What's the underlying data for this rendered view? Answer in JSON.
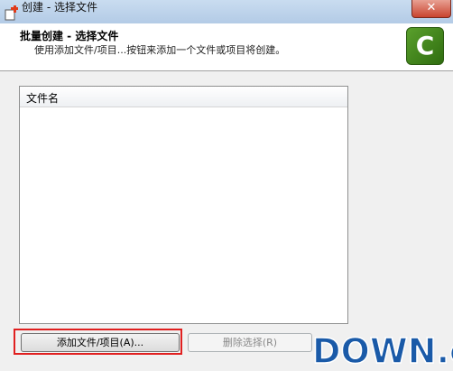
{
  "window": {
    "title": "创建 - 选择文件",
    "close_symbol": "✕",
    "app_icon": "app-window-icon"
  },
  "header": {
    "title": "批量创建 - 选择文件",
    "subtitle": "使用添加文件/项目...按钮来添加一个文件或项目将创建。",
    "logo_letter": "C",
    "logo_icon": "camtasia-logo-icon"
  },
  "file_list": {
    "columns": [
      "文件名"
    ],
    "rows": []
  },
  "buttons": {
    "add_label": "添加文件/项目(A)...",
    "remove_label": "删除选择(R)"
  },
  "watermark": {
    "text": "DOWN.cc"
  },
  "colors": {
    "highlight": "#e02020",
    "logo_green": "#4a8f1f",
    "watermark_blue": "#1a5aa8",
    "watermark_yellow": "#f5b800"
  }
}
